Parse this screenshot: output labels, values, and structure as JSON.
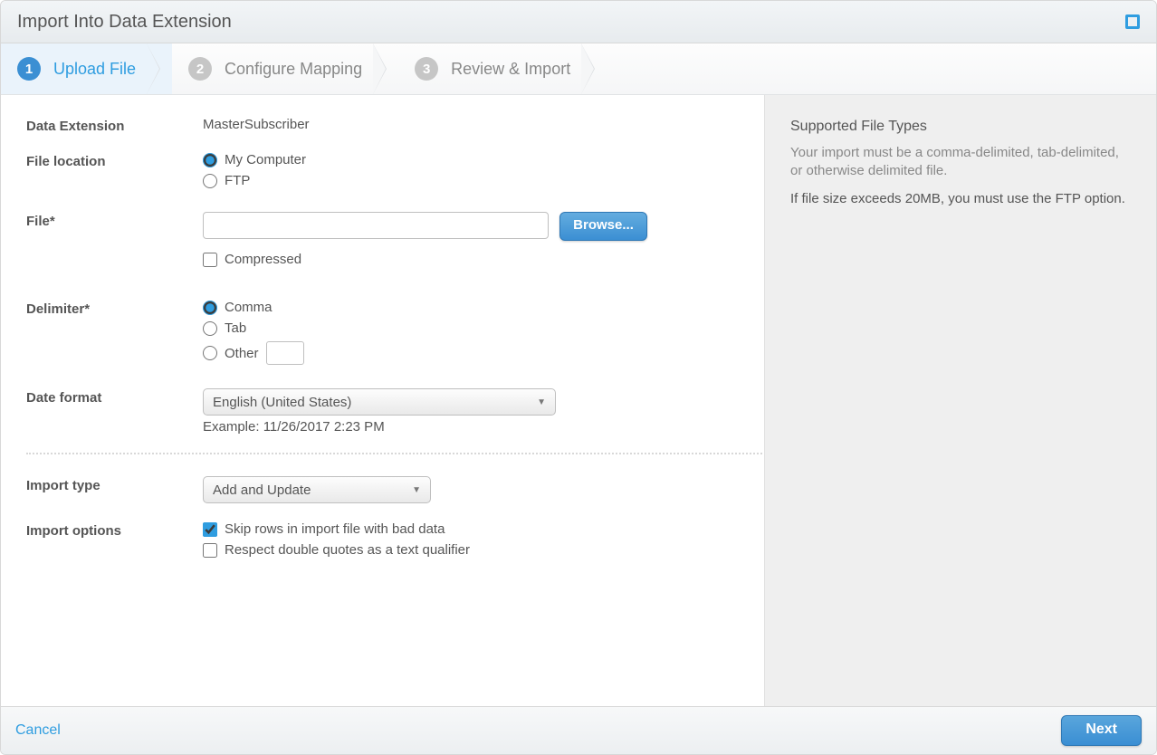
{
  "window_title": "Import Into Data Extension",
  "steps": [
    {
      "num": "1",
      "label": "Upload File"
    },
    {
      "num": "2",
      "label": "Configure Mapping"
    },
    {
      "num": "3",
      "label": "Review & Import"
    }
  ],
  "labels": {
    "data_extension": "Data Extension",
    "file_location": "File location",
    "file": "File*",
    "delimiter": "Delimiter*",
    "date_format": "Date format",
    "import_type": "Import type",
    "import_options": "Import options"
  },
  "values": {
    "data_extension": "MasterSubscriber",
    "file_location_my_computer": "My Computer",
    "file_location_ftp": "FTP",
    "browse": "Browse...",
    "compressed": "Compressed",
    "delimiter_comma": "Comma",
    "delimiter_tab": "Tab",
    "delimiter_other": "Other",
    "date_format_selected": "English (United States)",
    "date_format_example": "Example: 11/26/2017 2:23 PM",
    "import_type_selected": "Add and Update",
    "opt_skip_bad": "Skip rows in import file with bad data",
    "opt_respect_quotes": "Respect double quotes as a text qualifier"
  },
  "sidebar": {
    "title": "Supported File Types",
    "p1": "Your import must be a comma-delimited, tab-delimited, or otherwise delimited file.",
    "p2": "If file size exceeds 20MB, you must use the FTP option."
  },
  "footer": {
    "cancel": "Cancel",
    "next": "Next"
  }
}
